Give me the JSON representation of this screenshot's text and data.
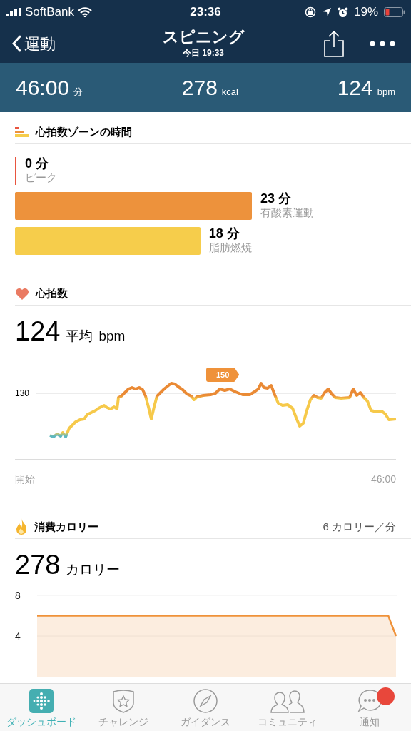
{
  "status_bar": {
    "carrier": "SoftBank",
    "time": "23:36",
    "battery": "19%"
  },
  "header": {
    "back": "運動",
    "title": "スピニング",
    "subtitle": "今日 19:33"
  },
  "stats": [
    {
      "value": "46:00",
      "unit": "分"
    },
    {
      "value": "278",
      "unit": "kcal"
    },
    {
      "value": "124",
      "unit": "bpm"
    }
  ],
  "zones": {
    "title": "心拍数ゾーンの時間",
    "items": [
      {
        "minutes": "0 分",
        "name": "ピーク",
        "color": "#e8553f"
      },
      {
        "minutes": "23 分",
        "name": "有酸素運動",
        "color": "#ed923c"
      },
      {
        "minutes": "18 分",
        "name": "脂肪燃焼",
        "color": "#f6cd4b"
      }
    ]
  },
  "heart_rate": {
    "title": "心拍数",
    "value": "124",
    "label": "平均",
    "unit": "bpm",
    "y_tick": "130",
    "peak_badge": "150",
    "start": "開始",
    "end": "46:00"
  },
  "calories": {
    "title": "消費カロリー",
    "rate": "6 カロリー／分",
    "value": "278",
    "unit": "カロリー",
    "chart_data": {
      "type": "area",
      "yticks": [
        4,
        8
      ],
      "ylim": [
        0,
        8
      ],
      "series": [
        {
          "color": "#ef923a",
          "values": [
            6,
            6,
            6,
            6,
            6,
            6,
            6,
            6,
            6,
            6,
            6,
            6,
            6,
            6,
            6,
            6,
            6,
            6,
            6,
            6,
            6,
            6,
            6,
            6,
            6,
            6,
            6,
            6,
            6,
            6,
            6,
            6,
            6,
            6,
            6,
            6,
            6,
            6,
            6,
            6,
            6,
            6,
            6,
            6,
            6,
            6,
            4
          ]
        }
      ]
    }
  },
  "tab_bar": [
    {
      "label": "ダッシュボード",
      "selected": true,
      "notification": false
    },
    {
      "label": "チャレンジ",
      "selected": false,
      "notification": false
    },
    {
      "label": "ガイダンス",
      "selected": false,
      "notification": false
    },
    {
      "label": "コミュニティ",
      "selected": false,
      "notification": false
    },
    {
      "label": "通知",
      "selected": false,
      "notification": true
    }
  ]
}
